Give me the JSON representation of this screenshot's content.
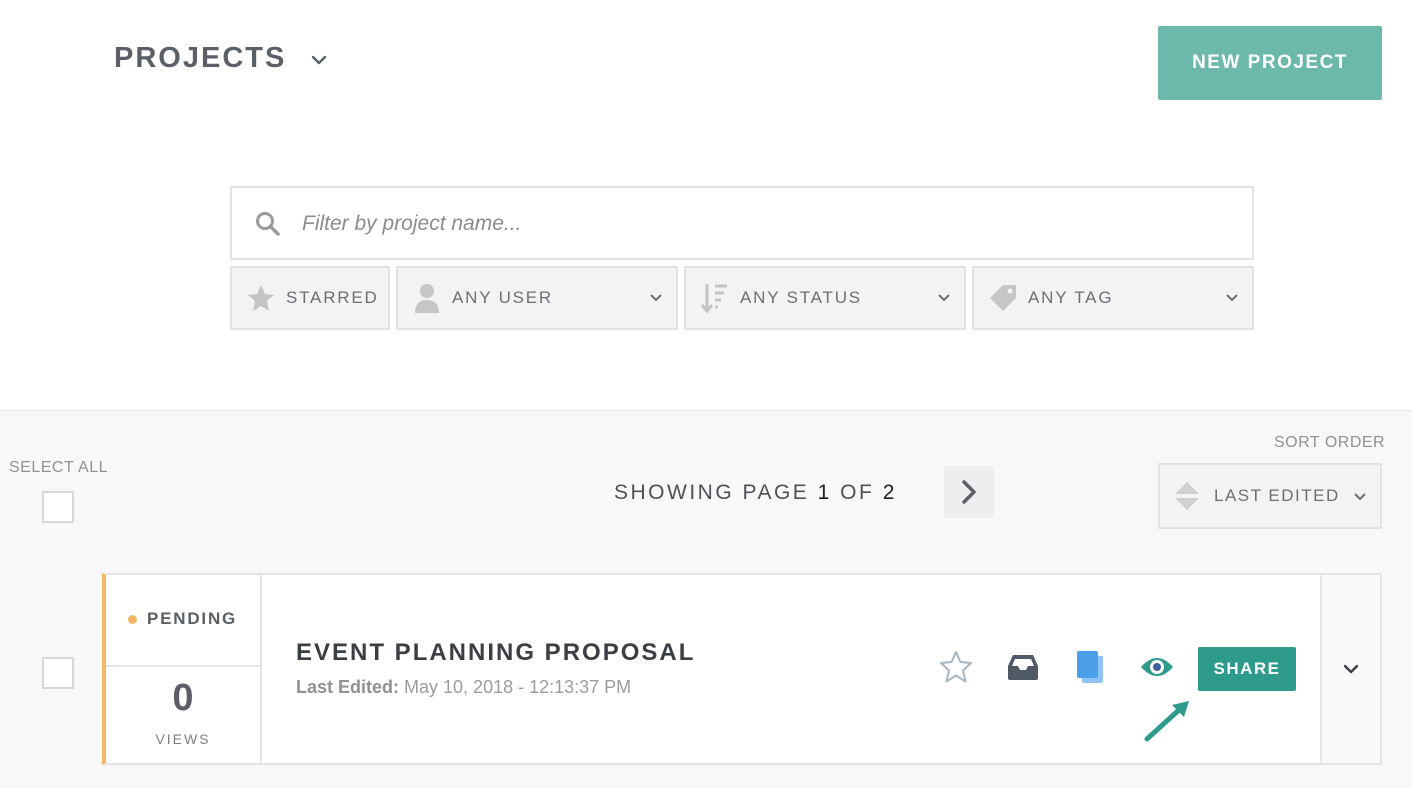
{
  "header": {
    "title": "PROJECTS",
    "new_project_label": "NEW PROJECT"
  },
  "search": {
    "placeholder": "Filter by project name...",
    "value": ""
  },
  "filters": {
    "starred": "STARRED",
    "user": "ANY USER",
    "status": "ANY STATUS",
    "tag": "ANY TAG"
  },
  "list": {
    "select_all_label": "SELECT ALL",
    "paging_prefix": "SHOWING PAGE",
    "current_page": "1",
    "of_label": "OF",
    "total_pages": "2",
    "sort_label": "SORT ORDER",
    "sort_value": "LAST EDITED"
  },
  "projects": [
    {
      "status": "PENDING",
      "views": "0",
      "views_label": "VIEWS",
      "title": "EVENT PLANNING PROPOSAL",
      "last_edited_label": "Last Edited:",
      "last_edited_value": "May 10, 2018 - 12:13:37 PM",
      "share_label": "SHARE"
    }
  ],
  "colors": {
    "accent": "#6cb8ab",
    "share": "#2e9a8c",
    "pending": "#f2b866",
    "copy_icon": "#4a9fe8",
    "archive_icon": "#4f5a66"
  },
  "icons": [
    "chevron-down-icon",
    "search-icon",
    "star-icon",
    "user-icon",
    "sort-icon",
    "tag-icon",
    "chevron-right-icon",
    "sort-arrows-icon",
    "archive-icon",
    "copy-icon",
    "eye-icon",
    "arrow-hint-icon"
  ]
}
